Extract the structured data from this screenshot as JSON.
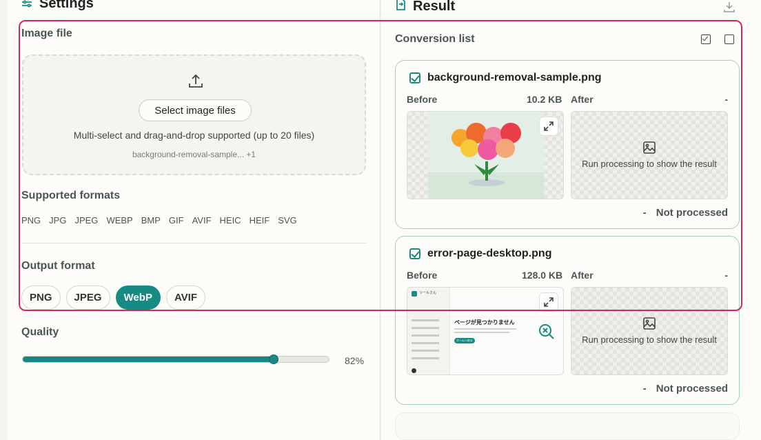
{
  "settings": {
    "title": "Settings",
    "image_file_label": "Image file",
    "select_button": "Select image files",
    "drop_hint": "Multi-select and drag-and-drop supported (up to 20 files)",
    "selected_files": "background-removal-sample... +1",
    "supported_formats_label": "Supported formats",
    "supported_formats": [
      "PNG",
      "JPG",
      "JPEG",
      "WEBP",
      "BMP",
      "GIF",
      "AVIF",
      "HEIC",
      "HEIF",
      "SVG"
    ],
    "output_format_label": "Output format",
    "output_formats": [
      "PNG",
      "JPEG",
      "WebP",
      "AVIF"
    ],
    "output_selected": "WebP",
    "quality_label": "Quality",
    "quality_value": 82,
    "quality_text": "82%"
  },
  "result": {
    "title": "Result",
    "conversion_list_label": "Conversion list",
    "items": [
      {
        "filename": "background-removal-sample.png",
        "before_label": "Before",
        "before_size": "10.2 KB",
        "after_label": "After",
        "after_size": "-",
        "placeholder": "Run processing to show the result",
        "status_size": "-",
        "status": "Not processed"
      },
      {
        "filename": "error-page-desktop.png",
        "before_label": "Before",
        "before_size": "128.0 KB",
        "after_label": "After",
        "after_size": "-",
        "placeholder": "Run processing to show the result",
        "status_size": "-",
        "status": "Not processed"
      }
    ],
    "preview_error_page": {
      "brand": "ツールさん",
      "heading": "ページが見つかりません",
      "button": "ホームへ戻る"
    }
  },
  "colors": {
    "accent": "#188a84",
    "highlight": "#d22b52"
  }
}
